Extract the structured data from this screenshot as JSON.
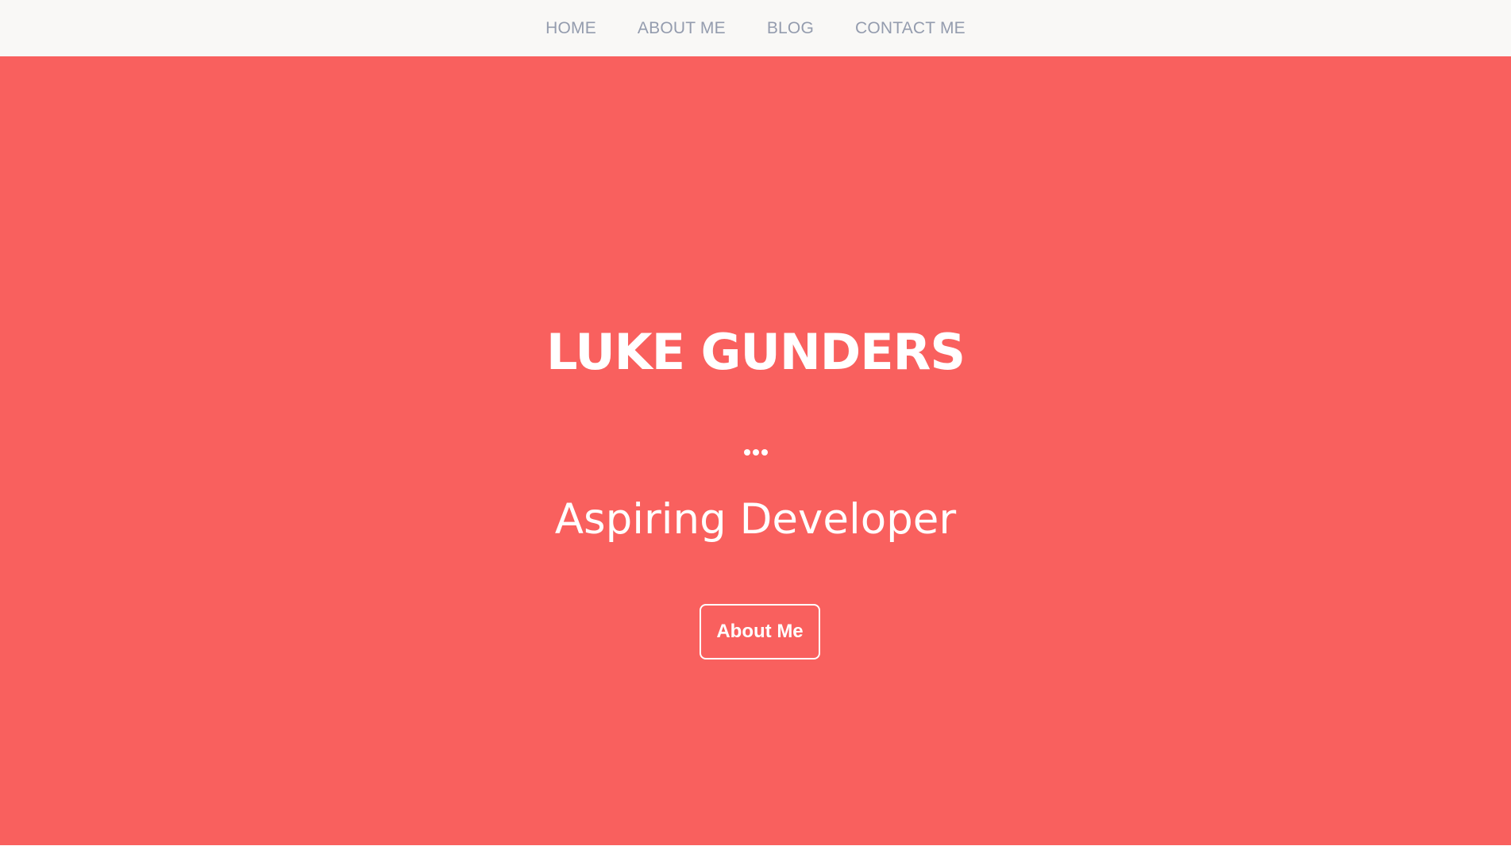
{
  "nav": {
    "items": [
      {
        "label": "HOME"
      },
      {
        "label": "ABOUT ME"
      },
      {
        "label": "BLOG"
      },
      {
        "label": "CONTACT ME"
      }
    ]
  },
  "hero": {
    "title": "LUKE GUNDERS",
    "subtitle": "Aspiring Developer",
    "button_label": "About Me",
    "divider_icon": "ellipsis-icon"
  },
  "colors": {
    "nav_background": "#f9f8f6",
    "nav_text": "#949cae",
    "hero_background": "#f9605e",
    "hero_text": "#ffffff"
  }
}
